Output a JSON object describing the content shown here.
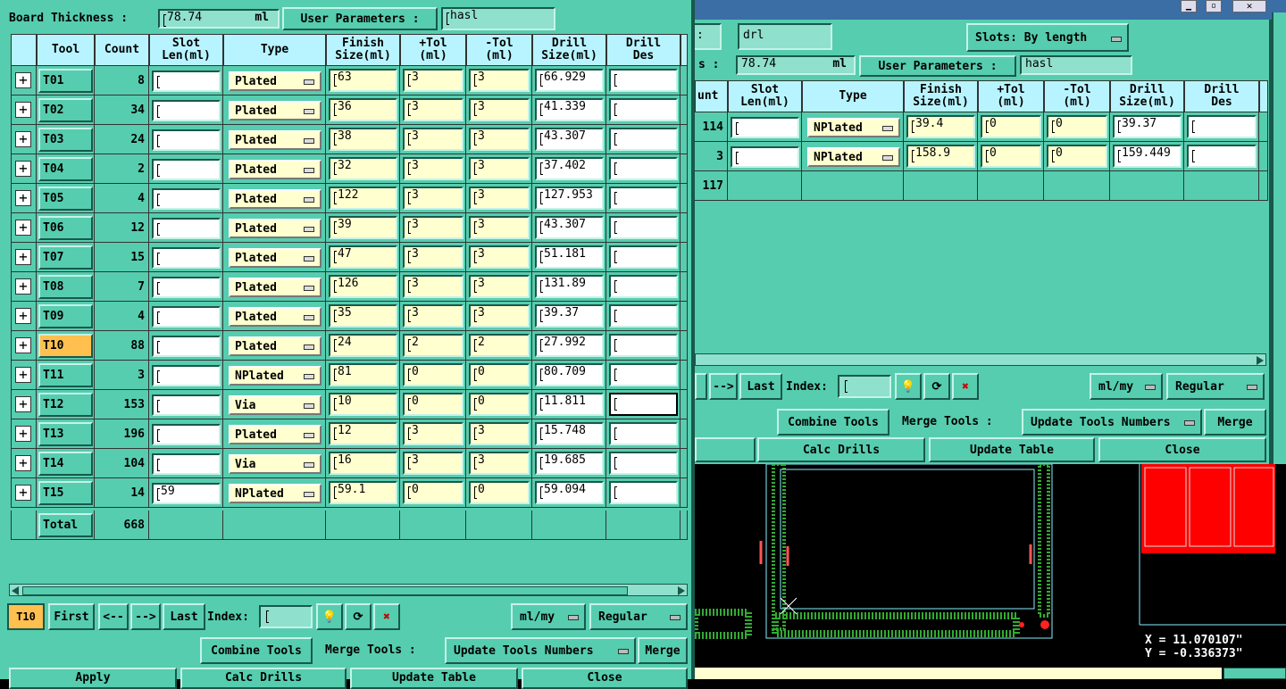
{
  "left_window": {
    "board_thickness_label": "Board Thickness :",
    "board_thickness_value": "78.74",
    "board_thickness_unit": "ml",
    "user_params_label": "User Parameters :",
    "user_params_value": "hasl",
    "columns": [
      "Tool",
      "Count",
      "Slot\nLen(ml)",
      "Type",
      "Finish\nSize(ml)",
      "+Tol\n(ml)",
      "-Tol\n(ml)",
      "Drill\nSize(ml)",
      "Drill\nDes"
    ],
    "rows": [
      {
        "tool": "T01",
        "count": "8",
        "slot": "",
        "type": "Plated",
        "finish": "63",
        "ptol": "3",
        "mtol": "3",
        "drill": "66.929",
        "des": ""
      },
      {
        "tool": "T02",
        "count": "34",
        "slot": "",
        "type": "Plated",
        "finish": "36",
        "ptol": "3",
        "mtol": "3",
        "drill": "41.339",
        "des": ""
      },
      {
        "tool": "T03",
        "count": "24",
        "slot": "",
        "type": "Plated",
        "finish": "38",
        "ptol": "3",
        "mtol": "3",
        "drill": "43.307",
        "des": ""
      },
      {
        "tool": "T04",
        "count": "2",
        "slot": "",
        "type": "Plated",
        "finish": "32",
        "ptol": "3",
        "mtol": "3",
        "drill": "37.402",
        "des": ""
      },
      {
        "tool": "T05",
        "count": "4",
        "slot": "",
        "type": "Plated",
        "finish": "122",
        "ptol": "3",
        "mtol": "3",
        "drill": "127.953",
        "des": ""
      },
      {
        "tool": "T06",
        "count": "12",
        "slot": "",
        "type": "Plated",
        "finish": "39",
        "ptol": "3",
        "mtol": "3",
        "drill": "43.307",
        "des": ""
      },
      {
        "tool": "T07",
        "count": "15",
        "slot": "",
        "type": "Plated",
        "finish": "47",
        "ptol": "3",
        "mtol": "3",
        "drill": "51.181",
        "des": ""
      },
      {
        "tool": "T08",
        "count": "7",
        "slot": "",
        "type": "Plated",
        "finish": "126",
        "ptol": "3",
        "mtol": "3",
        "drill": "131.89",
        "des": ""
      },
      {
        "tool": "T09",
        "count": "4",
        "slot": "",
        "type": "Plated",
        "finish": "35",
        "ptol": "3",
        "mtol": "3",
        "drill": "39.37",
        "des": ""
      },
      {
        "tool": "T10",
        "count": "88",
        "slot": "",
        "type": "Plated",
        "finish": "24",
        "ptol": "2",
        "mtol": "2",
        "drill": "27.992",
        "des": "",
        "selected": true
      },
      {
        "tool": "T11",
        "count": "3",
        "slot": "",
        "type": "NPlated",
        "finish": "81",
        "ptol": "0",
        "mtol": "0",
        "drill": "80.709",
        "des": ""
      },
      {
        "tool": "T12",
        "count": "153",
        "slot": "",
        "type": "Via",
        "finish": "10",
        "ptol": "0",
        "mtol": "0",
        "drill": "11.811",
        "des": "",
        "focus": true
      },
      {
        "tool": "T13",
        "count": "196",
        "slot": "",
        "type": "Plated",
        "finish": "12",
        "ptol": "3",
        "mtol": "3",
        "drill": "15.748",
        "des": ""
      },
      {
        "tool": "T14",
        "count": "104",
        "slot": "",
        "type": "Via",
        "finish": "16",
        "ptol": "3",
        "mtol": "3",
        "drill": "19.685",
        "des": ""
      },
      {
        "tool": "T15",
        "count": "14",
        "slot": "59",
        "type": "NPlated",
        "finish": "59.1",
        "ptol": "0",
        "mtol": "0",
        "drill": "59.094",
        "des": ""
      }
    ],
    "total_label": "Total",
    "total_count": "668",
    "current_tool": "T10",
    "nav": {
      "first": "First",
      "prev": "<--",
      "next": "-->",
      "last": "Last",
      "index_label": "Index:",
      "index_value": ""
    },
    "units_select": "ml/my",
    "mode_select": "Regular",
    "combine_tools": "Combine Tools",
    "merge_tools_label": "Merge Tools :",
    "update_tools_numbers": "Update Tools Numbers",
    "merge": "Merge",
    "bottom_buttons": [
      "Apply",
      "Calc Drills",
      "Update Table",
      "Close"
    ]
  },
  "right_window": {
    "drl_value": "drl",
    "slots_label": "Slots:",
    "slots_select": "By length",
    "thickness_label_tail": "s :",
    "thickness_value": "78.74",
    "thickness_unit": "ml",
    "user_params_label": "User Parameters :",
    "user_params_value": "hasl",
    "col_partial": "unt",
    "columns": [
      "Slot\nLen(ml)",
      "Type",
      "Finish\nSize(ml)",
      "+Tol\n(ml)",
      "-Tol\n(ml)",
      "Drill\nSize(ml)",
      "Drill\nDes"
    ],
    "rows": [
      {
        "count": "114",
        "slot": "",
        "type": "NPlated",
        "finish": "39.4",
        "ptol": "0",
        "mtol": "0",
        "drill": "39.37",
        "des": ""
      },
      {
        "count": "3",
        "slot": "",
        "type": "NPlated",
        "finish": "158.9",
        "ptol": "0",
        "mtol": "0",
        "drill": "159.449",
        "des": ""
      }
    ],
    "total_count": "117",
    "nav": {
      "next": "-->",
      "last": "Last",
      "index_label": "Index:"
    },
    "units_select": "ml/my",
    "mode_select": "Regular",
    "combine_tools": "Combine Tools",
    "merge_tools_label": "Merge Tools :",
    "update_tools_numbers": "Update Tools Numbers",
    "merge": "Merge",
    "calc_drills": "Calc Drills",
    "update_table": "Update Table",
    "close": "Close"
  },
  "cad": {
    "coord_x": "X = 11.070107\"",
    "coord_y": "Y = -0.336373\""
  }
}
